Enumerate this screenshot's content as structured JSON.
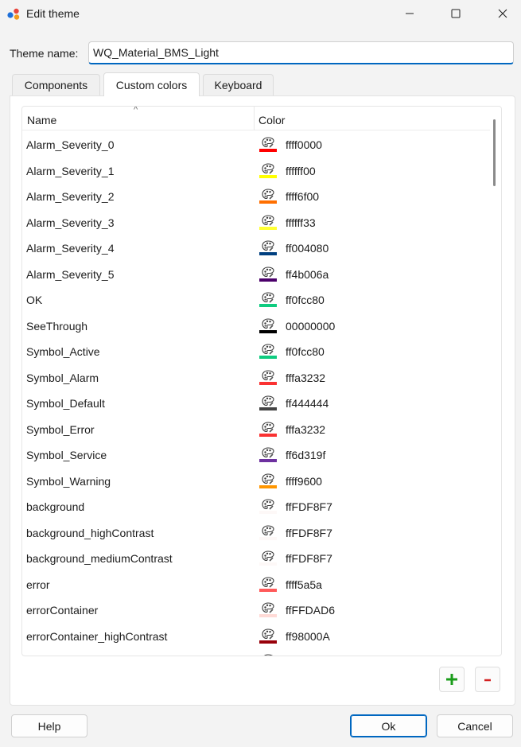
{
  "window": {
    "title": "Edit theme"
  },
  "form": {
    "theme_name_label": "Theme name:",
    "theme_name_value": "WQ_Material_BMS_Light"
  },
  "tabs": [
    {
      "label": "Components",
      "active": false
    },
    {
      "label": "Custom colors",
      "active": true
    },
    {
      "label": "Keyboard",
      "active": false
    }
  ],
  "table": {
    "headers": {
      "name": "Name",
      "color": "Color"
    },
    "sort_indicator": "^",
    "rows": [
      {
        "name": "Alarm_Severity_0",
        "hex": "ffff0000",
        "swatch": "#ff0000"
      },
      {
        "name": "Alarm_Severity_1",
        "hex": "ffffff00",
        "swatch": "#ffff00"
      },
      {
        "name": "Alarm_Severity_2",
        "hex": "ffff6f00",
        "swatch": "#ff6f00"
      },
      {
        "name": "Alarm_Severity_3",
        "hex": "ffffff33",
        "swatch": "#ffff33"
      },
      {
        "name": "Alarm_Severity_4",
        "hex": "ff004080",
        "swatch": "#004080"
      },
      {
        "name": "Alarm_Severity_5",
        "hex": "ff4b006a",
        "swatch": "#4b006a"
      },
      {
        "name": "OK",
        "hex": "ff0fcc80",
        "swatch": "#0fcc80"
      },
      {
        "name": "SeeThrough",
        "hex": "00000000",
        "swatch": "#000000"
      },
      {
        "name": "Symbol_Active",
        "hex": "ff0fcc80",
        "swatch": "#0fcc80"
      },
      {
        "name": "Symbol_Alarm",
        "hex": "fffa3232",
        "swatch": "#fa3232"
      },
      {
        "name": "Symbol_Default",
        "hex": "ff444444",
        "swatch": "#444444"
      },
      {
        "name": "Symbol_Error",
        "hex": "fffa3232",
        "swatch": "#fa3232"
      },
      {
        "name": "Symbol_Service",
        "hex": "ff6d319f",
        "swatch": "#6d319f"
      },
      {
        "name": "Symbol_Warning",
        "hex": "ffff9600",
        "swatch": "#ff9600"
      },
      {
        "name": "background",
        "hex": "ffFDF8F7",
        "swatch": "#FDF8F7"
      },
      {
        "name": "background_highContrast",
        "hex": "ffFDF8F7",
        "swatch": "#FDF8F7"
      },
      {
        "name": "background_mediumContrast",
        "hex": "ffFDF8F7",
        "swatch": "#FDF8F7"
      },
      {
        "name": "error",
        "hex": "ffff5a5a",
        "swatch": "#ff5a5a"
      },
      {
        "name": "errorContainer",
        "hex": "ffFFDAD6",
        "swatch": "#FFDAD6"
      },
      {
        "name": "errorContainer_highContrast",
        "hex": "ff98000A",
        "swatch": "#98000A"
      },
      {
        "name": "",
        "hex": "",
        "swatch": "#ffffff"
      }
    ]
  },
  "actions": {
    "add_symbol": "+",
    "remove_symbol": "-"
  },
  "buttons": {
    "help": "Help",
    "ok": "Ok",
    "cancel": "Cancel"
  },
  "colors": {
    "accent": "#0067c0",
    "add_green": "#1a9c1a",
    "remove_red": "#d32020"
  }
}
